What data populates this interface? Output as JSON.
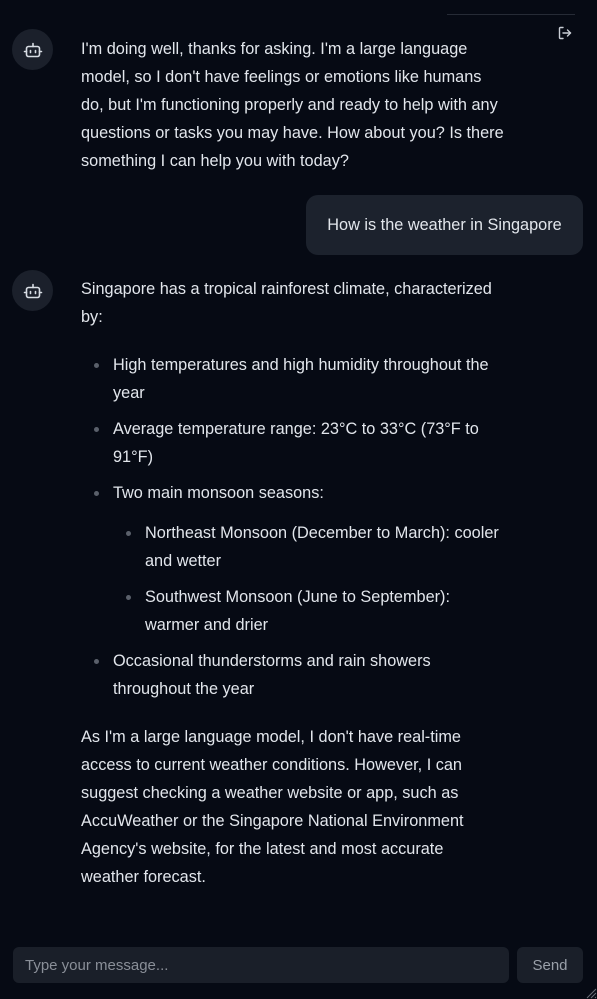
{
  "messages": {
    "bot_1": "I'm doing well, thanks for asking. I'm a large language model, so I don't have feelings or emotions like humans do, but I'm functioning properly and ready to help with any questions or tasks you may have. How about you? Is there something I can help you with today?",
    "user_1": "How is the weather in Singapore",
    "bot_2": {
      "intro": "Singapore has a tropical rainforest climate, characterized by:",
      "bullets": [
        "High temperatures and high humidity throughout the year",
        "Average temperature range: 23°C to 33°C (73°F to 91°F)",
        "Two main monsoon seasons:",
        "Occasional thunderstorms and rain showers throughout the year"
      ],
      "sub_bullets": [
        "Northeast Monsoon (December to March): cooler and wetter",
        "Southwest Monsoon (June to September): warmer and drier"
      ],
      "closing": "As I'm a large language model, I don't have real-time access to current weather conditions. However, I can suggest checking a weather website or app, such as AccuWeather or the Singapore National Environment Agency's website, for the latest and most accurate weather forecast."
    }
  },
  "composer": {
    "placeholder": "Type your message...",
    "value": ""
  },
  "send_label": "Send",
  "icons": {
    "bot": "bot-icon",
    "logout": "logout-icon"
  },
  "colors": {
    "background": "#060a14",
    "bubble": "#1c222d",
    "avatar": "#1b202b",
    "input": "#1a1f29",
    "text": "#e2e6ec"
  }
}
